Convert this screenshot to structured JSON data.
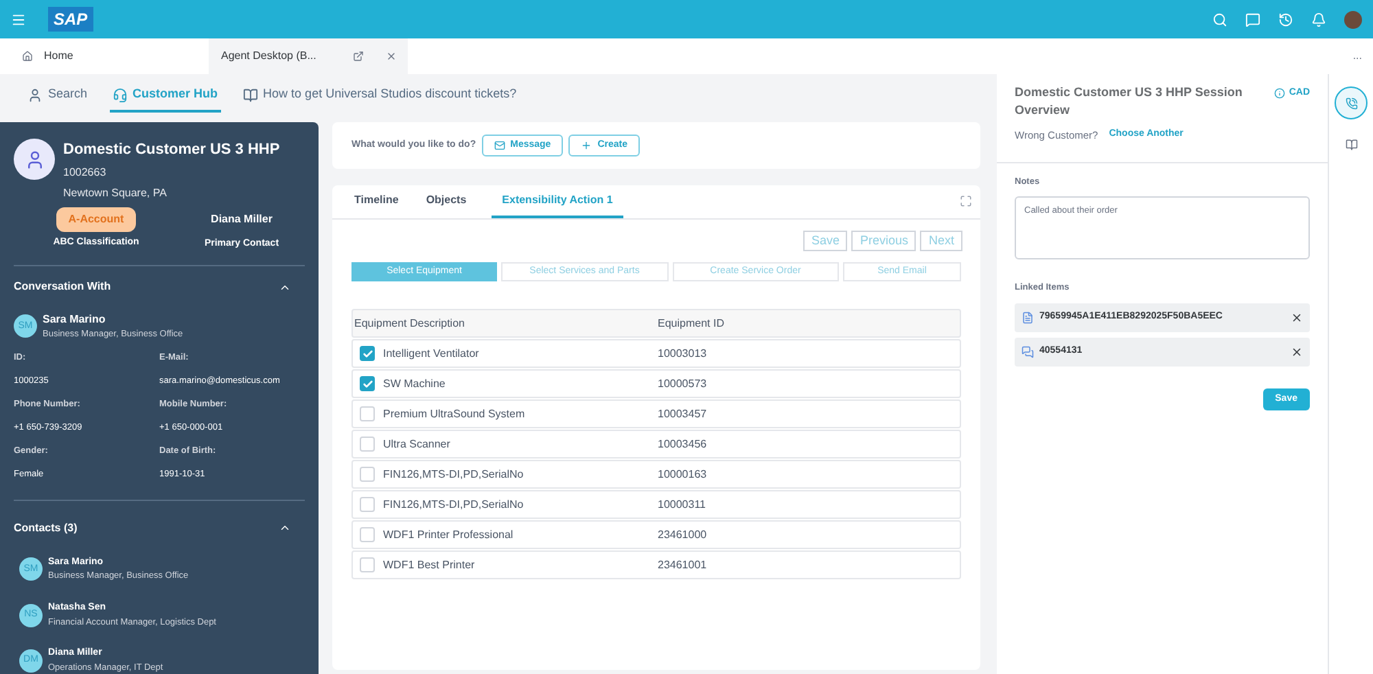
{
  "header": {
    "logo": "SAP"
  },
  "app_tabs": [
    {
      "label": "Home",
      "selected": false,
      "kind": "home"
    },
    {
      "label": "Agent Desktop (B...",
      "selected": true,
      "kind": "closable"
    }
  ],
  "more": "...",
  "nav_tabs": [
    {
      "label": "Search",
      "selected": false,
      "kind": "search"
    },
    {
      "label": "Customer Hub",
      "selected": true,
      "kind": "hub"
    },
    {
      "label": "How to get Universal Studios discount tickets?",
      "selected": false,
      "kind": "article"
    }
  ],
  "customer": {
    "name": "Domestic Customer US 3 HHP",
    "id": "1002663",
    "location": "Newtown Square, PA",
    "badge": "A-Account",
    "badge_caption": "ABC Classification",
    "contact": "Diana Miller",
    "contact_caption": "Primary Contact"
  },
  "conversation": {
    "title": "Conversation With",
    "expanded": true,
    "person": {
      "initials": "SM",
      "name": "Sara Marino",
      "role": "Business Manager, Business Office"
    },
    "fields": [
      {
        "label": "ID:",
        "value": "1000235"
      },
      {
        "label": "E-Mail:",
        "value": "sara.marino@domesticus.com"
      },
      {
        "label": "Phone Number:",
        "value": "+1 650-739-3209"
      },
      {
        "label": "Mobile Number:",
        "value": "+1 650-000-001"
      },
      {
        "label": "Gender:",
        "value": "Female"
      },
      {
        "label": "Date of Birth:",
        "value": "1991-10-31"
      }
    ]
  },
  "contacts": {
    "title": "Contacts (3)",
    "expanded": true,
    "items": [
      {
        "initials": "SM",
        "name": "Sara Marino",
        "role": "Business Manager, Business Office"
      },
      {
        "initials": "NS",
        "name": "Natasha Sen",
        "role": "Financial Account Manager, Logistics Dept"
      },
      {
        "initials": "DM",
        "name": "Diana Miller",
        "role": "Operations Manager, IT Dept"
      }
    ]
  },
  "actions": {
    "prompt": "What would you like to do?",
    "buttons": [
      {
        "label": "Message",
        "kind": "message"
      },
      {
        "label": "Create",
        "kind": "create"
      }
    ]
  },
  "detail_tabs": [
    {
      "label": "Timeline",
      "selected": false
    },
    {
      "label": "Objects",
      "selected": false
    },
    {
      "label": "Extensibility Action 1",
      "selected": true
    }
  ],
  "wizard_buttons": [
    "Save",
    "Previous",
    "Next"
  ],
  "steps": [
    {
      "label": "Select Equipment",
      "selected": true
    },
    {
      "label": "Select Services and Parts",
      "selected": false
    },
    {
      "label": "Create Service Order",
      "selected": false
    },
    {
      "label": "Send Email",
      "selected": false
    }
  ],
  "table": {
    "columns": [
      "Equipment Description",
      "Equipment ID"
    ],
    "rows": [
      {
        "description": "Intelligent Ventilator",
        "id": "10003013",
        "checked": true
      },
      {
        "description": "SW Machine",
        "id": "10000573",
        "checked": true
      },
      {
        "description": "Premium UltraSound System",
        "id": "10003457",
        "checked": false
      },
      {
        "description": "Ultra Scanner",
        "id": "10003456",
        "checked": false
      },
      {
        "description": "FIN126,MTS-DI,PD,SerialNo",
        "id": "10000163",
        "checked": false
      },
      {
        "description": "FIN126,MTS-DI,PD,SerialNo",
        "id": "10000311",
        "checked": false
      },
      {
        "description": "WDF1 Printer Professional",
        "id": "23461000",
        "checked": false
      },
      {
        "description": "WDF1 Best Printer",
        "id": "23461001",
        "checked": false
      }
    ]
  },
  "session": {
    "title": "Domestic Customer US 3 HHP Session Overview",
    "cad": "CAD",
    "wrong": "Wrong Customer?",
    "choose": "Choose Another",
    "notes_label": "Notes",
    "notes": "Called about their order",
    "linked_label": "Linked Items",
    "linked": [
      {
        "text": "79659945A1E411EB8292025F50BA5EEC",
        "kind": "document"
      },
      {
        "text": "40554131",
        "kind": "chat"
      }
    ],
    "save": "Save"
  }
}
